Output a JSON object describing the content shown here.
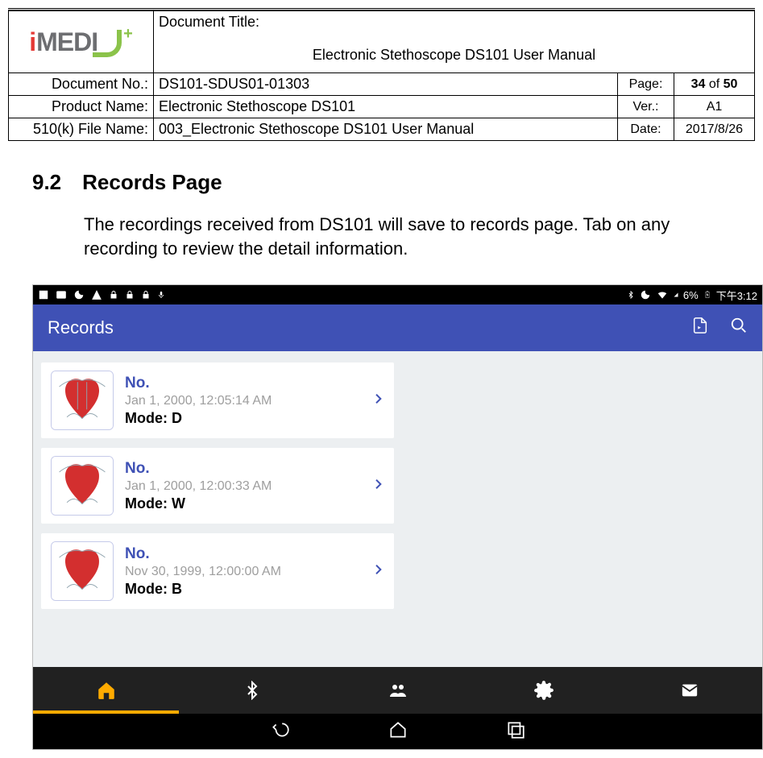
{
  "header": {
    "doc_title_label": "Document Title:",
    "doc_title_value": "Electronic Stethoscope DS101 User Manual",
    "doc_no_label": "Document No.:",
    "doc_no_value": "DS101-SDUS01-01303",
    "page_label": "Page:",
    "page_current": "34",
    "page_of": " of ",
    "page_total": "50",
    "product_label": "Product Name:",
    "product_value": "Electronic Stethoscope DS101",
    "ver_label": "Ver.:",
    "ver_value": "A1",
    "file_label": "510(k) File Name:",
    "file_value": "003_Electronic Stethoscope DS101 User Manual",
    "date_label": "Date:",
    "date_value": "2017/8/26",
    "logo_text_i": "i",
    "logo_text_rest": "MEDI",
    "logo_plus": "+"
  },
  "section": {
    "number": "9.2",
    "title": "Records Page",
    "body": "The recordings received from DS101 will save to records page. Tab on any recording to review the detail information."
  },
  "statusbar": {
    "battery_pct": "6%",
    "time": "下午3:12"
  },
  "app": {
    "title": "Records",
    "no_label": "No.",
    "mode_prefix": "Mode: ",
    "records": [
      {
        "date": "Jan 1, 2000, 12:05:14 AM",
        "mode": "D"
      },
      {
        "date": "Jan 1, 2000, 12:00:33 AM",
        "mode": "W"
      },
      {
        "date": "Nov 30, 1999, 12:00:00 AM",
        "mode": "B"
      }
    ]
  }
}
